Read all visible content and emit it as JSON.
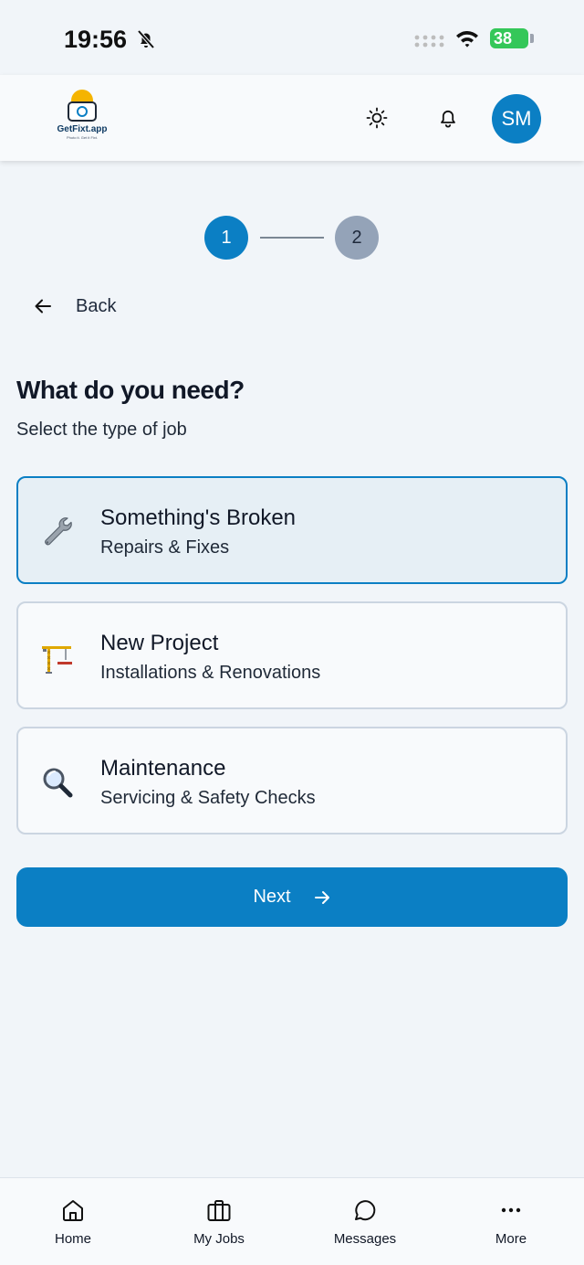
{
  "status_bar": {
    "time": "19:56",
    "battery": "38"
  },
  "header": {
    "logo_text": "GetFixt.app",
    "logo_tagline": "Photo it. Get it Fixt.",
    "avatar_initials": "SM"
  },
  "stepper": {
    "step1": "1",
    "step2": "2",
    "current_step": 1
  },
  "back_label": "Back",
  "heading": "What do you need?",
  "subheading": "Select the type of job",
  "options": [
    {
      "title": "Something's Broken",
      "subtitle": "Repairs & Fixes",
      "icon": "wrench-icon",
      "selected": true
    },
    {
      "title": "New Project",
      "subtitle": "Installations & Renovations",
      "icon": "crane-icon",
      "selected": false
    },
    {
      "title": "Maintenance",
      "subtitle": "Servicing & Safety Checks",
      "icon": "magnifier-icon",
      "selected": false
    }
  ],
  "next_label": "Next",
  "nav": [
    {
      "label": "Home",
      "icon": "home-icon"
    },
    {
      "label": "My Jobs",
      "icon": "briefcase-icon"
    },
    {
      "label": "Messages",
      "icon": "chat-icon"
    },
    {
      "label": "More",
      "icon": "more-icon"
    }
  ],
  "colors": {
    "primary": "#0b7fc4",
    "background": "#f1f5f9",
    "selected_card_bg": "#e6eff5",
    "inactive_step": "#94a3b8",
    "battery": "#34c759"
  }
}
